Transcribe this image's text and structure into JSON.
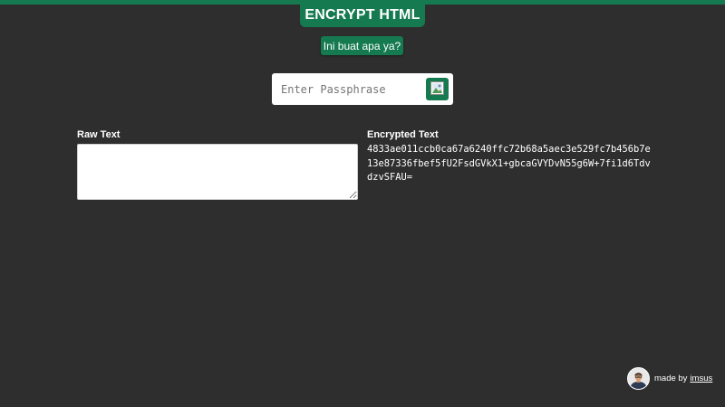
{
  "header": {
    "title": "ENCRYPT HTML",
    "help_label": "Ini buat apa ya?"
  },
  "passphrase": {
    "placeholder": "Enter Passphrase",
    "value": "",
    "button_icon": "image-icon"
  },
  "raw": {
    "label": "Raw Text",
    "value": ""
  },
  "encrypted": {
    "label": "Encrypted Text",
    "value": "4833ae011ccb0ca67a6240ffc72b68a5aec3e529fc7b456b7e13e87336fbef5fU2FsdGVkX1+gbcaGVYDvN55g6W+7fi1d6TdvdzvSFAU="
  },
  "footer": {
    "made_by": "made by",
    "author": "imsus"
  },
  "colors": {
    "accent": "#157a4f",
    "background": "#2e2e2e",
    "text": "#ffffff"
  }
}
